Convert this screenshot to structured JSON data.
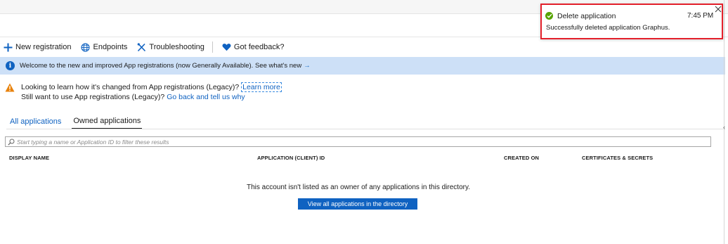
{
  "toolbar": {
    "new_registration": "New registration",
    "endpoints": "Endpoints",
    "troubleshooting": "Troubleshooting",
    "feedback": "Got feedback?"
  },
  "info_banner": {
    "text": "Welcome to the new and improved App registrations (now Generally Available). See what's new",
    "arrow": "→",
    "icon": "info-icon"
  },
  "legacy_notice": {
    "line1": "Looking to learn how it's changed from App registrations (Legacy)?",
    "learn_more": "Learn more",
    "line2": "Still want to use App registrations (Legacy)?",
    "go_back": "Go back and tell us why",
    "icon": "warning-icon"
  },
  "tabs": {
    "all_applications": "All applications",
    "owned_applications": "Owned applications",
    "active": "Owned applications"
  },
  "search": {
    "placeholder": "Start typing a name or Application ID to filter these results"
  },
  "table": {
    "columns": [
      "DISPLAY NAME",
      "APPLICATION (CLIENT) ID",
      "CREATED ON",
      "CERTIFICATES & SECRETS"
    ]
  },
  "empty_state": {
    "message": "This account isn't listed as an owner of any applications in this directory.",
    "button": "View all applications in the directory"
  },
  "toast": {
    "title": "Delete application",
    "time": "7:45 PM",
    "body": "Successfully deleted application Graphus.",
    "status": "success"
  },
  "colors": {
    "accent": "#0f62c1",
    "info_bg": "#cde0f7",
    "success": "#57a300",
    "warning": "#e8820c",
    "highlight_border": "#e3202b"
  }
}
